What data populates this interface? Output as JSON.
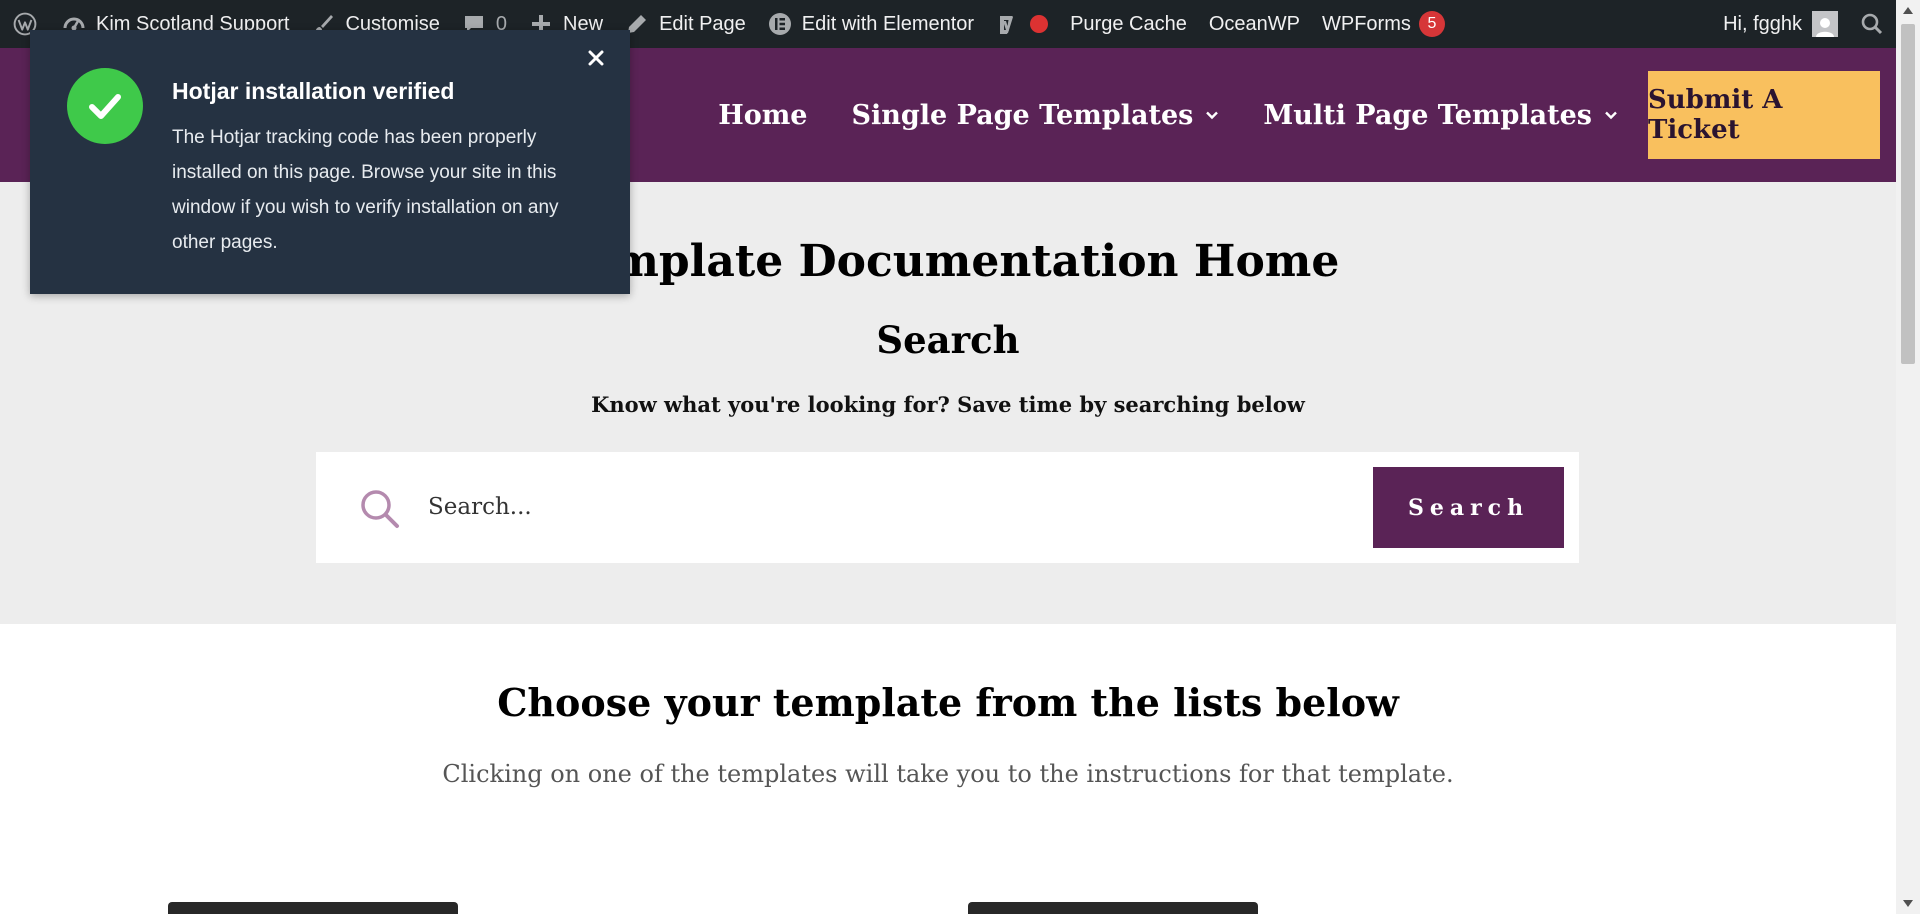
{
  "admin_bar": {
    "site_name": "Kim Scotland Support",
    "customise": "Customise",
    "comments_count": "0",
    "new": "New",
    "edit_page": "Edit Page",
    "edit_elementor": "Edit with Elementor",
    "purge_cache": "Purge Cache",
    "oceanwp": "OceanWP",
    "wpforms": "WPForms",
    "wpforms_count": "5",
    "greeting": "Hi, fgghk"
  },
  "nav": {
    "home": "Home",
    "single_page": "Single Page Templates",
    "multi_page": "Multi Page Templates",
    "ticket": "Submit A Ticket"
  },
  "hero": {
    "title": "Template Documentation Home",
    "search_heading": "Search",
    "search_sub": "Know what you're looking for? Save time by searching below",
    "search_placeholder": "Search...",
    "search_button": "Search"
  },
  "templates": {
    "heading": "Choose your template from the lists below",
    "subtext": "Clicking on one of the templates will take you to the instructions for that template."
  },
  "hotjar": {
    "title": "Hotjar installation verified",
    "body": "The Hotjar tracking code has been properly installed on this page. Browse your site in this window if you wish to verify installation on any other pages."
  },
  "colors": {
    "brand_purple": "#5a2356",
    "ticket_yellow": "#f9c05e",
    "admin_bar": "#1d2327",
    "toast_bg": "#253242",
    "success_green": "#3fc94a"
  }
}
